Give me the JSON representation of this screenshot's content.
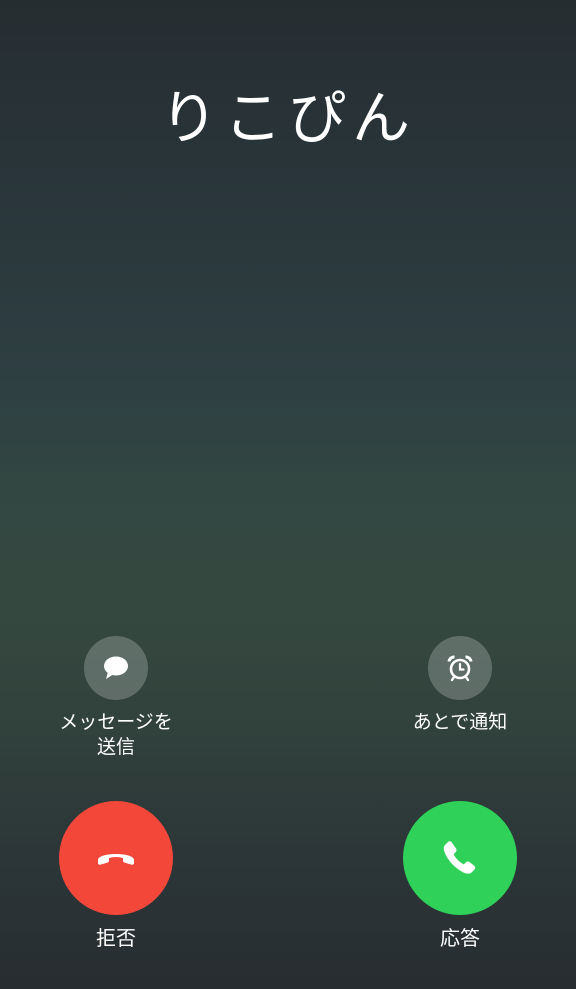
{
  "caller": {
    "name": "りこぴん"
  },
  "actions": {
    "message": {
      "label": "メッセージを\n送信",
      "icon": "speech-bubble-icon"
    },
    "remind": {
      "label": "あとで通知",
      "icon": "alarm-clock-icon"
    },
    "decline": {
      "label": "拒否",
      "icon": "phone-hangup-icon",
      "color": "#f3473a"
    },
    "accept": {
      "label": "応答",
      "icon": "phone-icon",
      "color": "#2fd158"
    }
  }
}
